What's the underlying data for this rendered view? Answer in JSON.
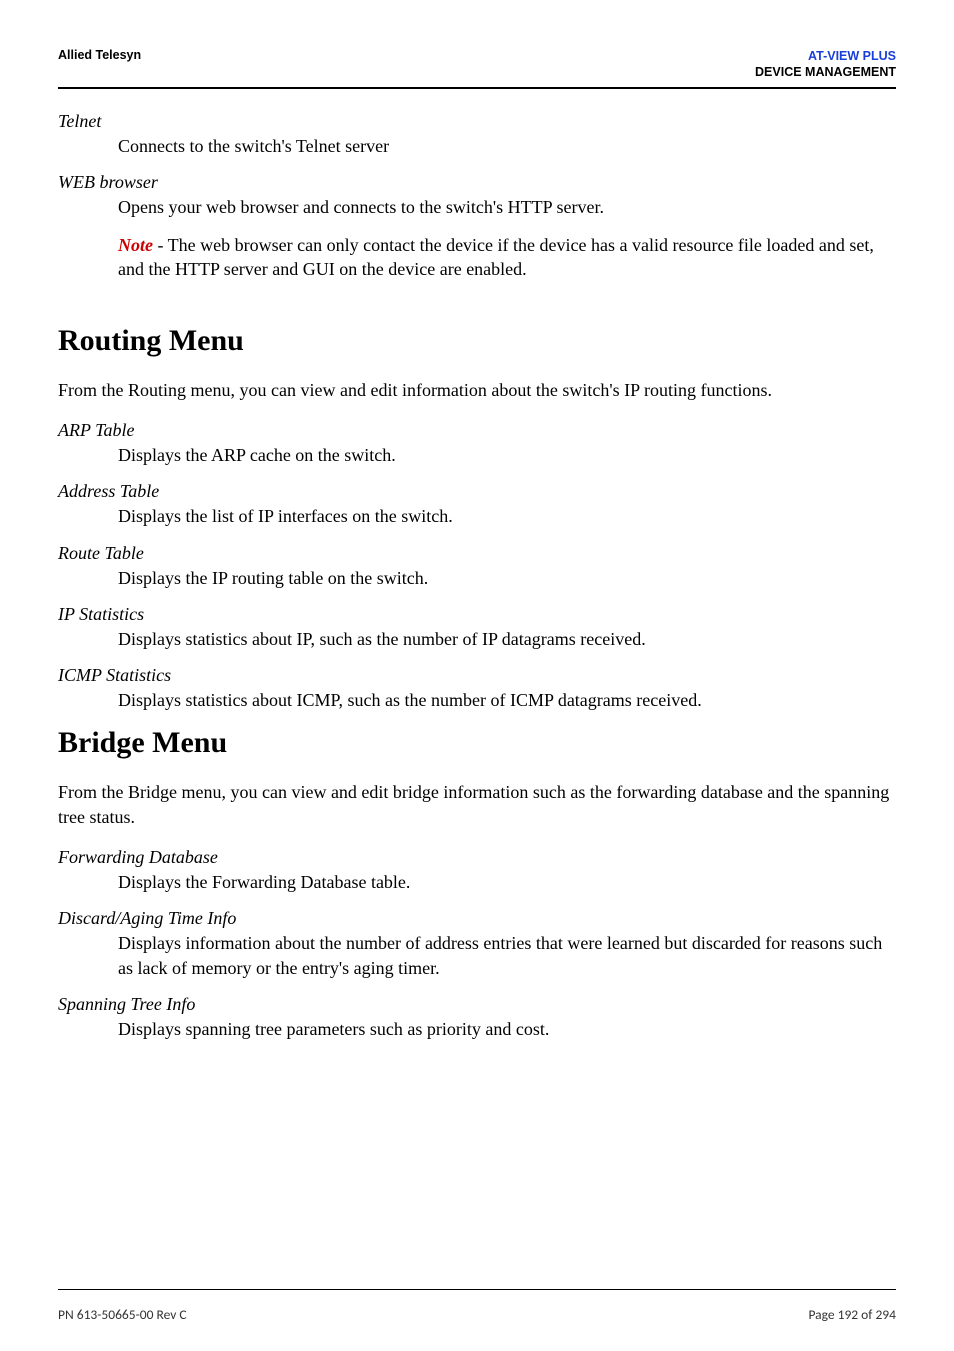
{
  "header": {
    "left": "Allied Telesyn",
    "right_line1": "AT-VIEW PLUS",
    "right_line2": "DEVICE MANAGEMENT"
  },
  "telnet": {
    "title": "Telnet",
    "body": "Connects to the switch's Telnet server"
  },
  "web": {
    "title": "WEB browser",
    "body": "Opens your web browser and connects to the switch's HTTP server.",
    "note_label": "Note",
    "note_rest": " - The web browser can only contact the device if the device has a valid resource file loaded and set, and the HTTP server and GUI on the device are enabled."
  },
  "routing": {
    "heading": "Routing Menu",
    "intro": "From the Routing menu, you can view and edit information about the switch's IP routing functions.",
    "items": [
      {
        "title": "ARP Table",
        "body": "Displays the ARP cache on the switch."
      },
      {
        "title": "Address Table",
        "body": "Displays the list of IP interfaces on the switch."
      },
      {
        "title": "Route Table",
        "body": "Displays the IP routing table on the switch."
      },
      {
        "title": "IP Statistics",
        "body": "Displays statistics about IP, such as the number of IP datagrams received."
      },
      {
        "title": "ICMP Statistics",
        "body": "Displays statistics about ICMP, such as the number of ICMP datagrams received."
      }
    ]
  },
  "bridge": {
    "heading": "Bridge Menu",
    "intro": "From the Bridge menu, you can view and edit bridge information such as the forwarding database and the spanning tree status.",
    "items": [
      {
        "title": "Forwarding Database",
        "body": "Displays the Forwarding Database table."
      },
      {
        "title": "Discard/Aging Time Info",
        "body": "Displays information about the number of address entries that were learned but discarded for reasons such as lack of memory or the entry's aging timer."
      },
      {
        "title": "Spanning Tree Info",
        "body": "Displays spanning tree parameters such as priority and cost."
      }
    ]
  },
  "footer": {
    "left": "PN 613-50665-00 Rev C",
    "right": "Page 192 of 294"
  }
}
